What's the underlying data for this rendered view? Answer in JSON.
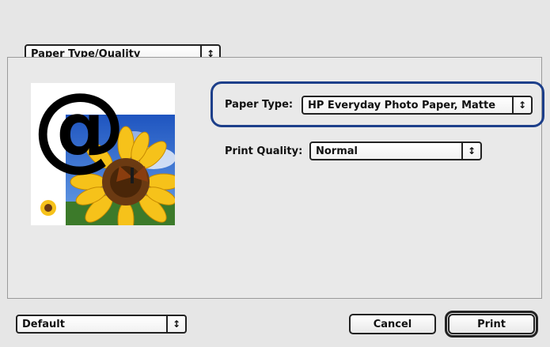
{
  "section_menu": {
    "value": "Paper Type/Quality"
  },
  "paper_type": {
    "label": "Paper Type:",
    "value": "HP Everyday Photo Paper, Matte"
  },
  "print_quality": {
    "label": "Print Quality:",
    "value": "Normal"
  },
  "preview": {
    "symbol": "@"
  },
  "presets": {
    "value": "Default"
  },
  "buttons": {
    "cancel": "Cancel",
    "print": "Print"
  },
  "icons": {
    "popup_arrows": "↕"
  },
  "colors": {
    "highlight": "#1d3f8a",
    "sky": "#2a63c8",
    "petal": "#f6c21a"
  }
}
